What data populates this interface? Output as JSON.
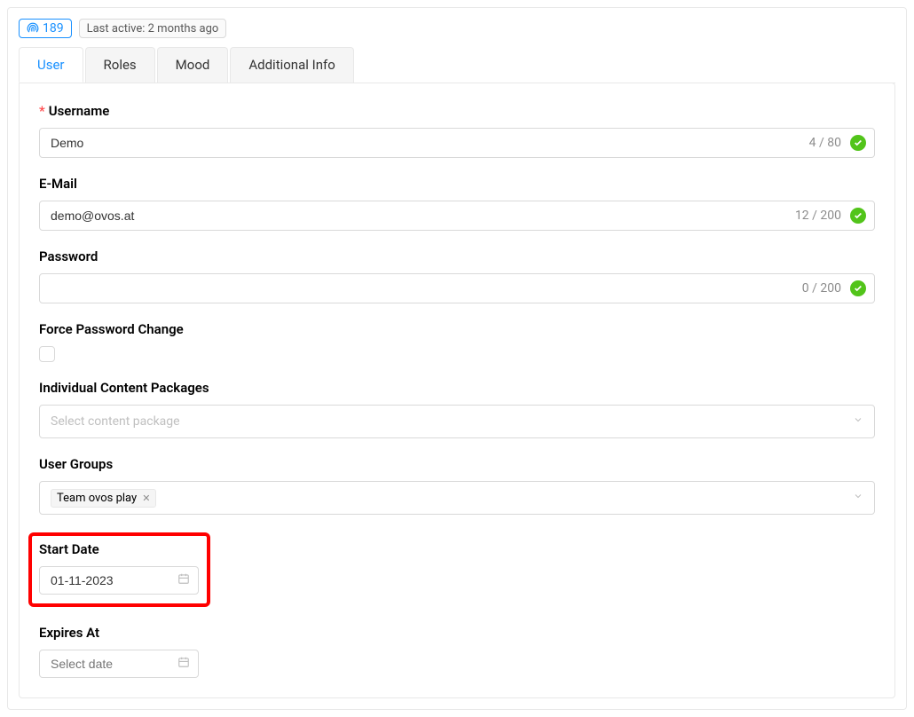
{
  "header": {
    "badge_number": "189",
    "last_active": "Last active: 2 months ago"
  },
  "tabs": {
    "user": "User",
    "roles": "Roles",
    "mood": "Mood",
    "additional_info": "Additional Info"
  },
  "form": {
    "username": {
      "label": "Username",
      "value": "Demo",
      "counter": "4 / 80"
    },
    "email": {
      "label": "E-Mail",
      "value": "demo@ovos.at",
      "counter": "12 / 200"
    },
    "password": {
      "label": "Password",
      "value": "",
      "counter": "0 / 200"
    },
    "force_password_change": {
      "label": "Force Password Change"
    },
    "content_packages": {
      "label": "Individual Content Packages",
      "placeholder": "Select content package"
    },
    "user_groups": {
      "label": "User Groups",
      "tags": [
        "Team ovos play"
      ]
    },
    "start_date": {
      "label": "Start Date",
      "value": "01-11-2023"
    },
    "expires_at": {
      "label": "Expires At",
      "placeholder": "Select date"
    }
  }
}
